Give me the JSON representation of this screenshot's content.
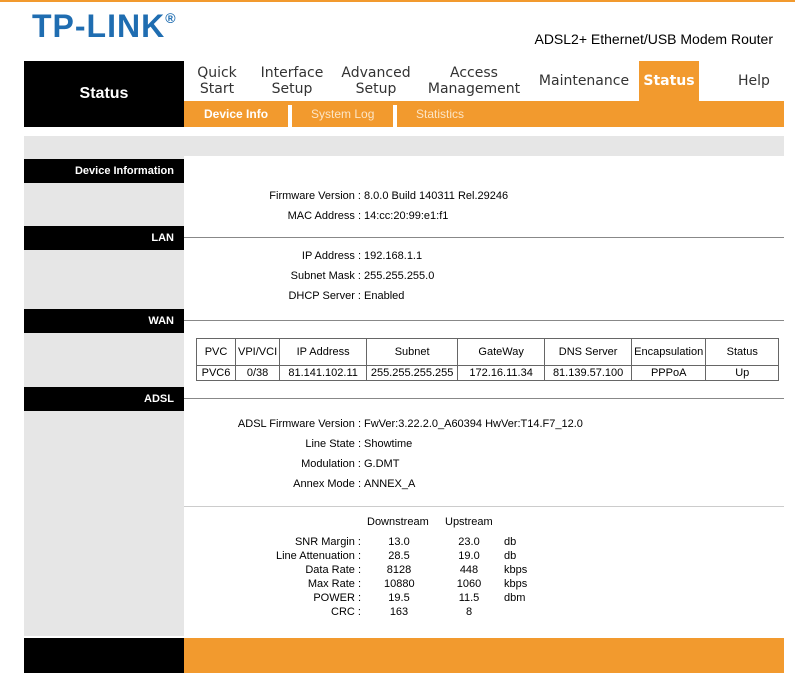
{
  "header": {
    "logo_text": "TP-LINK",
    "logo_mark": "®",
    "product_name": "ADSL2+ Ethernet/USB Modem Router"
  },
  "sidebar": {
    "title": "Status"
  },
  "nav": {
    "items": [
      {
        "line1": "Quick",
        "line2": "Start"
      },
      {
        "line1": "Interface",
        "line2": "Setup"
      },
      {
        "line1": "Advanced",
        "line2": "Setup"
      },
      {
        "line1": "Access",
        "line2": "Management"
      },
      {
        "line1": "Maintenance",
        "line2": ""
      },
      {
        "line1": "Status",
        "line2": ""
      },
      {
        "line1": "Help",
        "line2": ""
      }
    ],
    "active": "Status"
  },
  "subnav": {
    "items": [
      "Device Info",
      "System Log",
      "Statistics"
    ],
    "active": "Device Info"
  },
  "device_info": {
    "header": "Device Information",
    "firmware_label": "Firmware Version :",
    "firmware_value": "8.0.0 Build 140311 Rel.29246",
    "mac_label": "MAC Address :",
    "mac_value": "14:cc:20:99:e1:f1"
  },
  "lan": {
    "header": "LAN",
    "ip_label": "IP Address :",
    "ip_value": "192.168.1.1",
    "mask_label": "Subnet Mask :",
    "mask_value": "255.255.255.0",
    "dhcp_label": "DHCP Server :",
    "dhcp_value": "Enabled"
  },
  "wan": {
    "header": "WAN",
    "columns": [
      "PVC",
      "VPI/VCI",
      "IP Address",
      "Subnet",
      "GateWay",
      "DNS Server",
      "Encapsulation",
      "Status"
    ],
    "rows": [
      [
        "PVC6",
        "0/38",
        "81.141.102.11",
        "255.255.255.255",
        "172.16.11.34",
        "81.139.57.100",
        "PPPoA",
        "Up"
      ]
    ]
  },
  "adsl": {
    "header": "ADSL",
    "fw_label": "ADSL Firmware Version :",
    "fw_value": "FwVer:3.22.2.0_A60394 HwVer:T14.F7_12.0",
    "line_state_label": "Line State :",
    "line_state_value": "Showtime",
    "modulation_label": "Modulation :",
    "modulation_value": "G.DMT",
    "annex_label": "Annex Mode :",
    "annex_value": "ANNEX_A",
    "stats_head_down": "Downstream",
    "stats_head_up": "Upstream",
    "stats": [
      {
        "label": "SNR Margin :",
        "down": "13.0",
        "up": "23.0",
        "unit": "db"
      },
      {
        "label": "Line Attenuation :",
        "down": "28.5",
        "up": "19.0",
        "unit": "db"
      },
      {
        "label": "Data Rate :",
        "down": "8128",
        "up": "448",
        "unit": "kbps"
      },
      {
        "label": "Max Rate :",
        "down": "10880",
        "up": "1060",
        "unit": "kbps"
      },
      {
        "label": "POWER :",
        "down": "19.5",
        "up": "11.5",
        "unit": "dbm"
      },
      {
        "label": "CRC :",
        "down": "163",
        "up": "8",
        "unit": ""
      }
    ]
  },
  "colors": {
    "accent": "#f29a2e",
    "brand": "#1f6db1",
    "panel": "#e6e6e6"
  }
}
